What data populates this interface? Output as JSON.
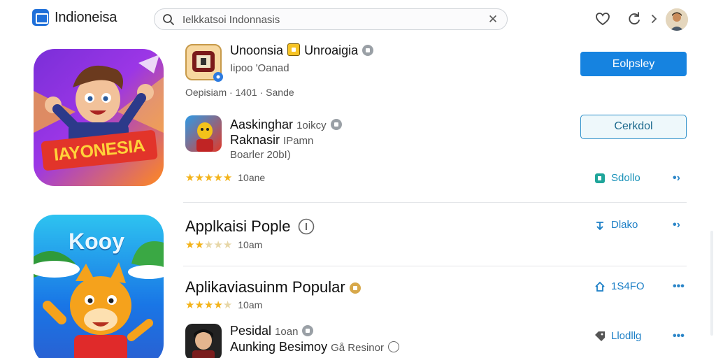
{
  "header": {
    "brand_name": "Indioneisa",
    "search_placeholder": "Ielkkatsoi Indonnasis",
    "search_value": "Ielkkatsoi Indonnasis"
  },
  "tiles": {
    "tile1_banner": "IAYONESIA",
    "tile2_logo": "Kooy"
  },
  "featured": {
    "title": "Unoonsia",
    "title_suffix": "Unroaigia",
    "publisher": "Iipoo 'Oanad",
    "meta": "Oepisiam · 1401 · Sande",
    "primary_button": "Eolpsley"
  },
  "item2": {
    "name": "Aaskinghar",
    "name_suffix": "1oikcy",
    "line2": "Raknasir",
    "line2_suffix": "IPamn",
    "line3": "Boarler 20bI)",
    "button": "Cerkdol",
    "rating_count": "10ane",
    "stars_full": 5,
    "stars_empty": 0,
    "side_label": "Sdollo"
  },
  "section1": {
    "title": "Applkaisi Pople",
    "rating_count": "10am",
    "stars_full": 2,
    "stars_empty": 3,
    "side_label": "Dlako"
  },
  "section2": {
    "title": "Aplikaviasuinm Popular",
    "rating_count": "10am",
    "stars_full": 4,
    "stars_empty": 1,
    "side_label": "1S4FO"
  },
  "item5": {
    "name": "Pesidal",
    "name_suffix": "1oan",
    "line2": "Aunking Besimoy",
    "line2_suffix": "Gå Resinor",
    "side_label": "Llodllg"
  },
  "colors": {
    "primary": "#1683e0",
    "star": "#f3b31a",
    "link": "#1c7fc6"
  }
}
